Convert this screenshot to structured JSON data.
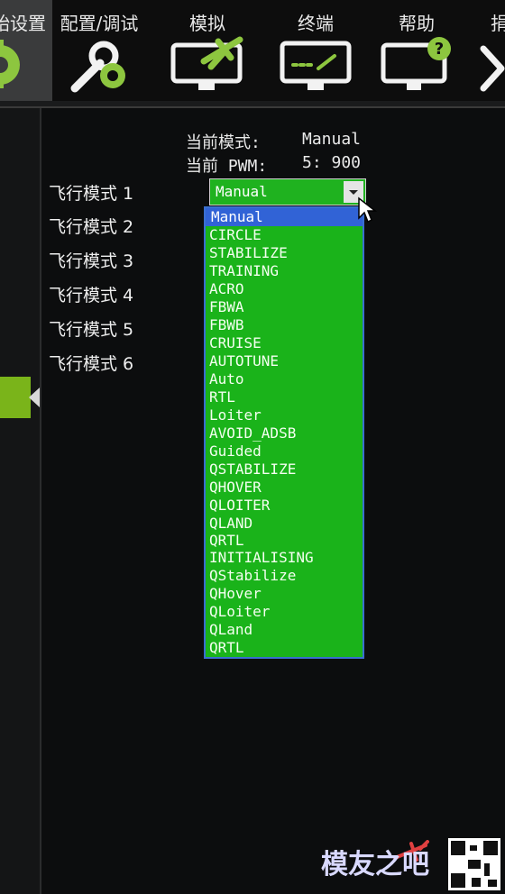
{
  "toolbar": {
    "items": [
      {
        "label": "始设置",
        "icon": "gear-icon"
      },
      {
        "label": "配置/调试",
        "icon": "wrench-gear-icon"
      },
      {
        "label": "模拟",
        "icon": "simulation-monitor-icon"
      },
      {
        "label": "终端",
        "icon": "terminal-monitor-icon"
      },
      {
        "label": "帮助",
        "icon": "help-monitor-icon"
      },
      {
        "label": "捐",
        "icon": "plane-icon"
      }
    ]
  },
  "status": {
    "current_mode_label": "当前模式:",
    "current_mode_value": "Manual",
    "current_pwm_label": "当前 PWM:",
    "current_pwm_value": "5: 900"
  },
  "flight_modes": [
    "飞行模式 1",
    "飞行模式 2",
    "飞行模式 3",
    "飞行模式 4",
    "飞行模式 5",
    "飞行模式 6"
  ],
  "dropdown": {
    "selected": "Manual",
    "options": [
      "Manual",
      "CIRCLE",
      "STABILIZE",
      "TRAINING",
      "ACRO",
      "FBWA",
      "FBWB",
      "CRUISE",
      "AUTOTUNE",
      "Auto",
      "RTL",
      "Loiter",
      "AVOID_ADSB",
      "Guided",
      "QSTABILIZE",
      "QHOVER",
      "QLOITER",
      "QLAND",
      "QRTL",
      "INITIALISING",
      "QStabilize",
      "QHover",
      "QLoiter",
      "QLand",
      "QRTL"
    ]
  },
  "watermark": {
    "text": "模友之吧"
  },
  "colors": {
    "accent": "#7ab41a",
    "dropdown_green": "#1ab31a",
    "selection_blue": "#3163d6"
  }
}
